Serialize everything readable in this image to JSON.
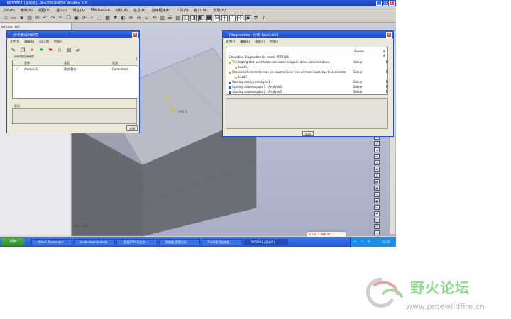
{
  "window": {
    "title": "PRT0001 (活动的) - Pro/ENGINEER Wildfire 5.0"
  },
  "menubar": [
    "文件(F)",
    "编辑(E)",
    "视图(V)",
    "插入(I)",
    "属性(A)",
    "Mechanica",
    "分析(A)",
    "信息(N)",
    "应用程序(P)",
    "工具(T)",
    "窗口(W)",
    "帮助(H)"
  ],
  "tree": {
    "root": "PRT0001.PRT"
  },
  "viewport": {
    "point_label": "APNT0",
    "coords": "X1 T1 OBJ"
  },
  "analyses_dialog": {
    "title": "分析和设计研究",
    "menu": [
      "文件(F)",
      "编辑(E)",
      "运行(R)",
      "信息(I)"
    ],
    "group_label": "分析和设计研究",
    "columns": [
      "名称",
      "类型",
      "状态"
    ],
    "rows": [
      {
        "name": "Analysis1",
        "type": "静态/静态",
        "status": "Completed"
      }
    ],
    "status_label": "状况",
    "close_button": "关闭"
  },
  "diagnostics_dialog": {
    "title": "Diagnostics : 分析 Analysis1",
    "menu": [
      "文件(F)",
      "编辑(E)",
      "视图(V)",
      "信息(I)"
    ],
    "severity_header": "Severe",
    "select_header": "选择",
    "header_line": "Simulation Diagnostics for model PRT0001",
    "items": [
      {
        "text": "The highlighted point loads can cause singular stress concentrations",
        "severity": "Solver",
        "kind": "expand"
      },
      {
        "text": "Load1",
        "severity": "",
        "kind": "child"
      },
      {
        "text": "Unchecked elements may be reported near one or more loads due to concentra",
        "severity": "Solver",
        "kind": "expand"
      },
      {
        "text": "Load1",
        "severity": "",
        "kind": "child"
      },
      {
        "text": "Starting analysis Analysis1",
        "severity": "Solver",
        "kind": "info"
      },
      {
        "text": "Starting solution pass 1 - Analysis1",
        "severity": "Solver",
        "kind": "info"
      },
      {
        "text": "Starting solution pass 2 - Analysis1",
        "severity": "Solver",
        "kind": "info"
      }
    ],
    "close_button": "关闭"
  },
  "taskbar": {
    "start": "开始",
    "tasks": [
      "Yahoo! Messenger",
      "Linda Huan (Linda)",
      "[原创]PRO/E应力...",
      "两根梁_受载分析",
      "Pro/E练习交流帖",
      "PRT0001 (活动的)"
    ],
    "time": "15:23"
  },
  "watermark": {
    "title": "野火论坛",
    "url": "www.proewildfire.cn"
  },
  "colors": {
    "accent": "#2456d6",
    "watermark_green": "#8fd68f"
  }
}
